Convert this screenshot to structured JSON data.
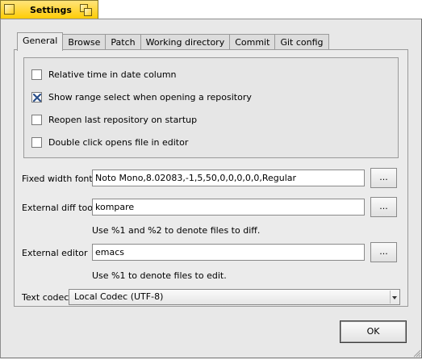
{
  "window": {
    "title": "Settings"
  },
  "tabs": [
    {
      "label": "General",
      "active": true
    },
    {
      "label": "Browse",
      "active": false
    },
    {
      "label": "Patch",
      "active": false
    },
    {
      "label": "Working directory",
      "active": false
    },
    {
      "label": "Commit",
      "active": false
    },
    {
      "label": "Git config",
      "active": false
    }
  ],
  "options": {
    "relative_time": {
      "label": "Relative time in date column",
      "checked": false
    },
    "range_select": {
      "label": "Show range select when opening a repository",
      "checked": true
    },
    "reopen_last": {
      "label": "Reopen last repository on startup",
      "checked": false
    },
    "double_click": {
      "label": "Double click opens file in editor",
      "checked": false
    }
  },
  "fields": {
    "font": {
      "label": "Fixed width font",
      "value": "Noto Mono,8.02083,-1,5,50,0,0,0,0,0,Regular",
      "button": "..."
    },
    "diff_tool": {
      "label": "External diff tool",
      "value": "kompare",
      "button": "...",
      "hint": "Use %1 and %2 to denote files to diff."
    },
    "editor": {
      "label": "External editor",
      "value": "emacs",
      "button": "...",
      "hint": "Use %1 to denote files to edit."
    },
    "codec": {
      "label": "Text codec",
      "value": "Local Codec (UTF-8)"
    }
  },
  "buttons": {
    "ok": "OK"
  },
  "icons": {
    "close": "close-box-icon",
    "zoom": "zoom-box-icon",
    "checkmark": "x-check-icon",
    "dropdown": "dropdown-arrow-icon",
    "resize": "resize-grip-icon"
  },
  "colors": {
    "title_tab": "#ffcb00",
    "window_bg": "#e8e8e8",
    "check_mark": "#2a4f8a"
  }
}
